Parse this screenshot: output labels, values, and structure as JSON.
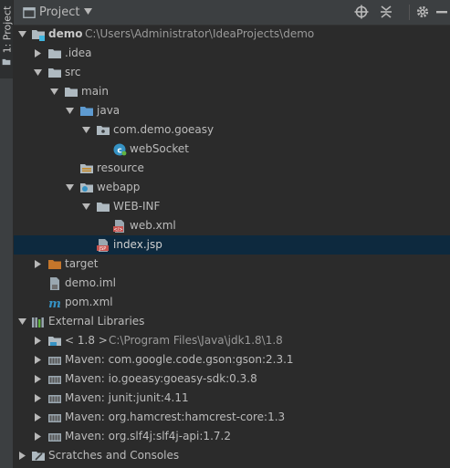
{
  "sidebar": {
    "tab_label": "1: Project"
  },
  "header": {
    "title": "Project"
  },
  "tree": {
    "demo": {
      "label": "demo",
      "path": "C:\\Users\\Administrator\\IdeaProjects\\demo"
    },
    "idea": "idea",
    "idea_prefix": ".",
    "src": "src",
    "main": "main",
    "java": "java",
    "pkg": "com.demo.goeasy",
    "websocket": "webSocket",
    "resource": "resource",
    "webapp": "webapp",
    "webinf": "WEB-INF",
    "webxml": "web.xml",
    "indexjsp": "index.jsp",
    "target": "target",
    "demoiml": "demo.iml",
    "pomxml": "pom.xml",
    "extlibs": "External Libraries",
    "jdk": {
      "label": "< 1.8 >",
      "path": "C:\\Program Files\\Java\\jdk1.8\\1.8"
    },
    "libs": [
      "Maven: com.google.code.gson:gson:2.3.1",
      "Maven: io.goeasy:goeasy-sdk:0.3.8",
      "Maven: junit:junit:4.11",
      "Maven: org.hamcrest:hamcrest-core:1.3",
      "Maven: org.slf4j:slf4j-api:1.7.2"
    ],
    "scratches": "Scratches and Consoles"
  },
  "colors": {
    "background": "#2b2b2b",
    "panel": "#3c3f41",
    "selection": "#0d293e",
    "text": "#bbbbbb"
  }
}
